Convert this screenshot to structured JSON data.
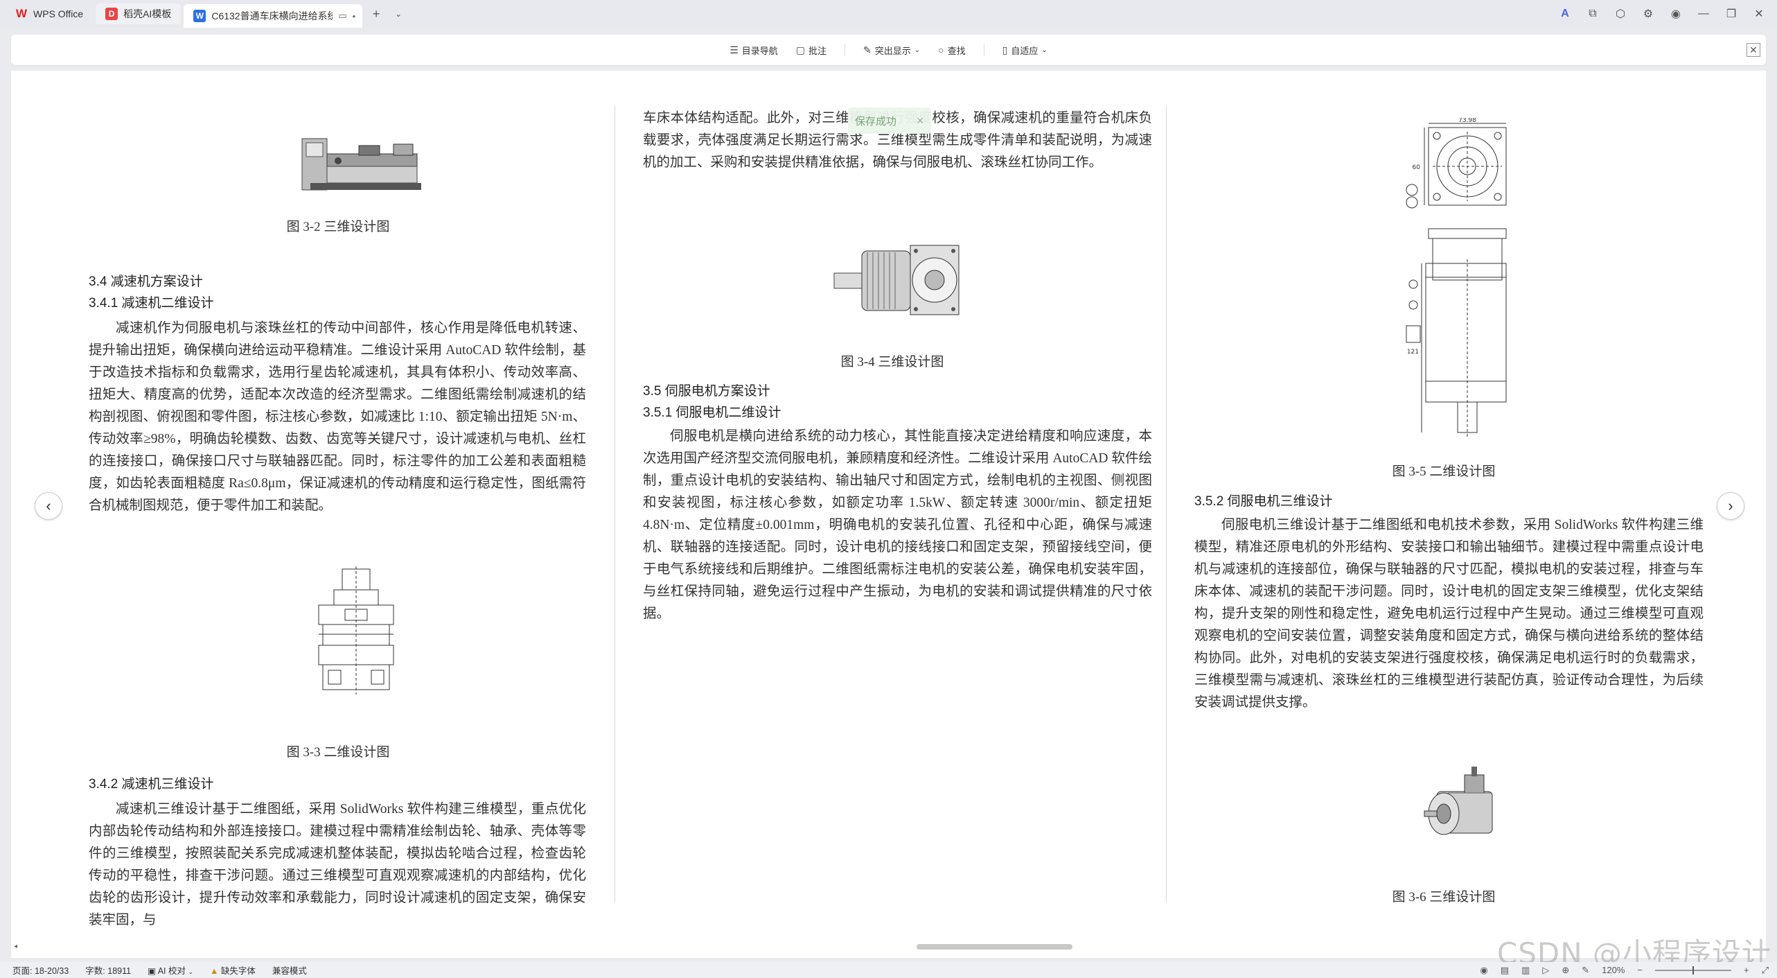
{
  "tabs": [
    {
      "label": "WPS Office",
      "icon": "wps-icon"
    },
    {
      "label": "稻壳AI模板",
      "icon": "daoke-ai-icon"
    },
    {
      "label": "C6132普通车床横向进给系统",
      "icon": "doc-icon"
    }
  ],
  "toolbar": {
    "toc": "目录导航",
    "comment": "批注",
    "highlight": "突出显示",
    "find": "查找",
    "fit": "自适应"
  },
  "toast": {
    "text": "保存成功"
  },
  "col1": {
    "fig2_caption": "图 3-2  三维设计图",
    "h_3_4": "3.4  减速机方案设计",
    "h_3_4_1": "3.4.1  减速机二维设计",
    "p1": "减速机作为伺服电机与滚珠丝杠的传动中间部件，核心作用是降低电机转速、提升输出扭矩，确保横向进给运动平稳精准。二维设计采用 AutoCAD 软件绘制，基于改造技术指标和负载需求，选用行星齿轮减速机，其具有体积小、传动效率高、扭矩大、精度高的优势，适配本次改造的经济型需求。二维图纸需绘制减速机的结构剖视图、俯视图和零件图，标注核心参数，如减速比 1:10、额定输出扭矩 5N·m、传动效率≥98%，明确齿轮模数、齿数、齿宽等关键尺寸，设计减速机与电机、丝杠的连接接口，确保接口尺寸与联轴器匹配。同时，标注零件的加工公差和表面粗糙度，如齿轮表面粗糙度 Ra≤0.8μm，保证减速机的传动精度和运行稳定性，图纸需符合机械制图规范，便于零件加工和装配。",
    "fig3_caption": "图 3-3  二维设计图",
    "h_3_4_2": "3.4.2  减速机三维设计",
    "p2": "减速机三维设计基于二维图纸，采用 SolidWorks 软件构建三维模型，重点优化内部齿轮传动结构和外部连接接口。建模过程中需精准绘制齿轮、轴承、壳体等零件的三维模型，按照装配关系完成减速机整体装配，模拟齿轮啮合过程，检查齿轮传动的平稳性，排查干涉问题。通过三维模型可直观观察减速机的内部结构，优化齿轮的齿形设计，提升传动效率和承载能力，同时设计减速机的固定支架，确保安装牢固，与"
  },
  "col2": {
    "p0": "车床本体结构适配。此外，对三维模型进行强度校核，确保减速机的重量符合机床负载要求，壳体强度满足长期运行需求。三维模型需生成零件清单和装配说明，为减速机的加工、采购和安装提供精准依据，确保与伺服电机、滚珠丝杠协同工作。",
    "fig4_caption": "图 3-4  三维设计图",
    "h_3_5": "3.5  伺服电机方案设计",
    "h_3_5_1": "3.5.1  伺服电机二维设计",
    "p1": "伺服电机是横向进给系统的动力核心，其性能直接决定进给精度和响应速度，本次选用国产经济型交流伺服电机，兼顾精度和经济性。二维设计采用 AutoCAD 软件绘制，重点设计电机的安装结构、输出轴尺寸和固定方式，绘制电机的主视图、侧视图和安装视图，标注核心参数，如额定功率 1.5kW、额定转速 3000r/min、额定扭矩 4.8N·m、定位精度±0.001mm，明确电机的安装孔位置、孔径和中心距，确保与减速机、联轴器的连接适配。同时，设计电机的接线接口和固定支架，预留接线空间，便于电气系统接线和后期维护。二维图纸需标注电机的安装公差，确保电机安装牢固，与丝杠保持同轴，避免运行过程中产生振动，为电机的安装和调试提供精准的尺寸依据。"
  },
  "col3": {
    "fig5_caption": "图 3-5  二维设计图",
    "h_3_5_2": "3.5.2  伺服电机三维设计",
    "p1": "伺服电机三维设计基于二维图纸和电机技术参数，采用 SolidWorks 软件构建三维模型，精准还原电机的外形结构、安装接口和输出轴细节。建模过程中需重点设计电机与减速机的连接部位，确保与联轴器的尺寸匹配，模拟电机的安装过程，排查与车床本体、减速机的装配干涉问题。同时，设计电机的固定支架三维模型，优化支架结构，提升支架的刚性和稳定性，避免电机运行过程中产生晃动。通过三维模型可直观观察电机的空间安装位置，调整安装角度和固定方式，确保与横向进给系统的整体结构协同。此外，对电机的安装支架进行强度校核，确保满足电机运行时的负载需求，三维模型需与减速机、滚珠丝杠的三维模型进行装配仿真，验证传动合理性，为后续安装调试提供支撑。",
    "fig6_caption": "图 3-6  三维设计图",
    "dim_top": "73.98",
    "dim_side": "60",
    "dim_len": "121"
  },
  "status": {
    "pages": "页面: 18-20/33",
    "words": "字数: 18911",
    "ai": "AI 校对",
    "font_missing": "缺失字体",
    "compat": "兼容模式",
    "zoom": "120%"
  },
  "watermark": "CSDN @小程序设计"
}
